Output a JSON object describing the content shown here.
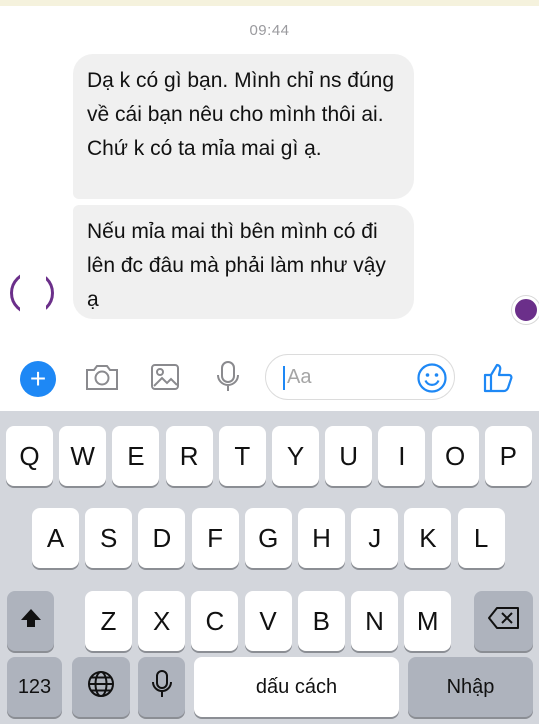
{
  "chat": {
    "timestamp": "09:44",
    "messages": [
      {
        "text": "Dạ k có gì bạn. Mình chỉ ns đúng về cái bạn nêu cho mình thôi ai. Chứ k có ta mỉa mai gì ạ."
      },
      {
        "text": "Nếu mỉa mai thì bên mình có đi lên đc đâu mà phải làm như vậy ạ"
      }
    ]
  },
  "composer": {
    "placeholder": "Aa",
    "icons": [
      "plus-icon",
      "camera-icon",
      "image-icon",
      "microphone-icon",
      "emoji-icon",
      "thumbs-up-icon"
    ],
    "accent": "#1e88f5"
  },
  "keyboard": {
    "row1": [
      "Q",
      "W",
      "E",
      "R",
      "T",
      "Y",
      "U",
      "I",
      "O",
      "P"
    ],
    "row2": [
      "A",
      "S",
      "D",
      "F",
      "G",
      "H",
      "J",
      "K",
      "L"
    ],
    "row3": [
      "Z",
      "X",
      "C",
      "V",
      "B",
      "N",
      "M"
    ],
    "numbers_label": "123",
    "space_label": "dấu cách",
    "return_label": "Nhập",
    "icons": [
      "shift-icon",
      "backspace-icon",
      "globe-icon",
      "dictation-icon"
    ]
  }
}
